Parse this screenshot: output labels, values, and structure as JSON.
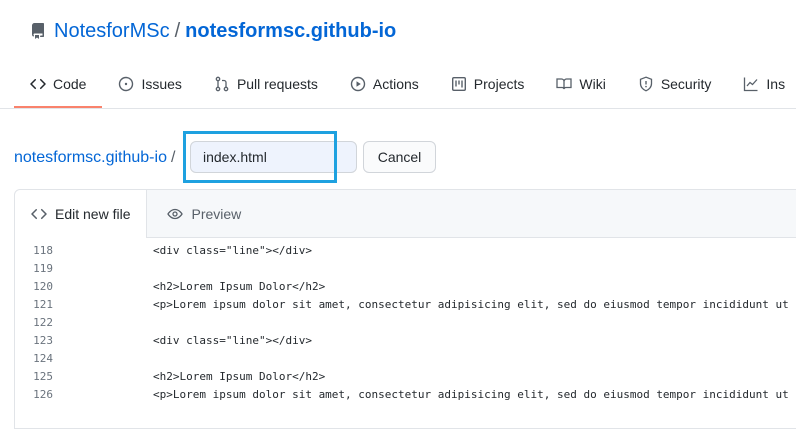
{
  "repo": {
    "owner": "NotesforMSc",
    "separator": "/",
    "name": "notesformsc.github-io"
  },
  "tabs": [
    {
      "label": "Code",
      "icon": "code-icon"
    },
    {
      "label": "Issues",
      "icon": "issue-icon"
    },
    {
      "label": "Pull requests",
      "icon": "pull-request-icon"
    },
    {
      "label": "Actions",
      "icon": "play-icon"
    },
    {
      "label": "Projects",
      "icon": "project-icon"
    },
    {
      "label": "Wiki",
      "icon": "book-icon"
    },
    {
      "label": "Security",
      "icon": "shield-icon"
    },
    {
      "label": "Ins",
      "icon": "graph-icon"
    }
  ],
  "breadcrumb": {
    "repo": "notesformsc.github-io",
    "separator": "/"
  },
  "filename": {
    "value": "index.html"
  },
  "cancel_label": "Cancel",
  "editor": {
    "edit_tab": "Edit new file",
    "preview_tab": "Preview"
  },
  "code_lines": [
    {
      "n": "118",
      "text": "<div class=\"line\"></div>"
    },
    {
      "n": "119",
      "text": ""
    },
    {
      "n": "120",
      "text": "<h2>Lorem Ipsum Dolor</h2>"
    },
    {
      "n": "121",
      "text": "<p>Lorem ipsum dolor sit amet, consectetur adipisicing elit, sed do eiusmod tempor incididunt ut"
    },
    {
      "n": "122",
      "text": ""
    },
    {
      "n": "123",
      "text": "<div class=\"line\"></div>"
    },
    {
      "n": "124",
      "text": ""
    },
    {
      "n": "125",
      "text": "<h2>Lorem Ipsum Dolor</h2>"
    },
    {
      "n": "126",
      "text": "<p>Lorem ipsum dolor sit amet, consectetur adipisicing elit, sed do eiusmod tempor incididunt ut"
    }
  ],
  "colors": {
    "link": "#0366d6",
    "highlight_border": "#1ea1e0",
    "active_tab_underline": "#f9826c"
  }
}
